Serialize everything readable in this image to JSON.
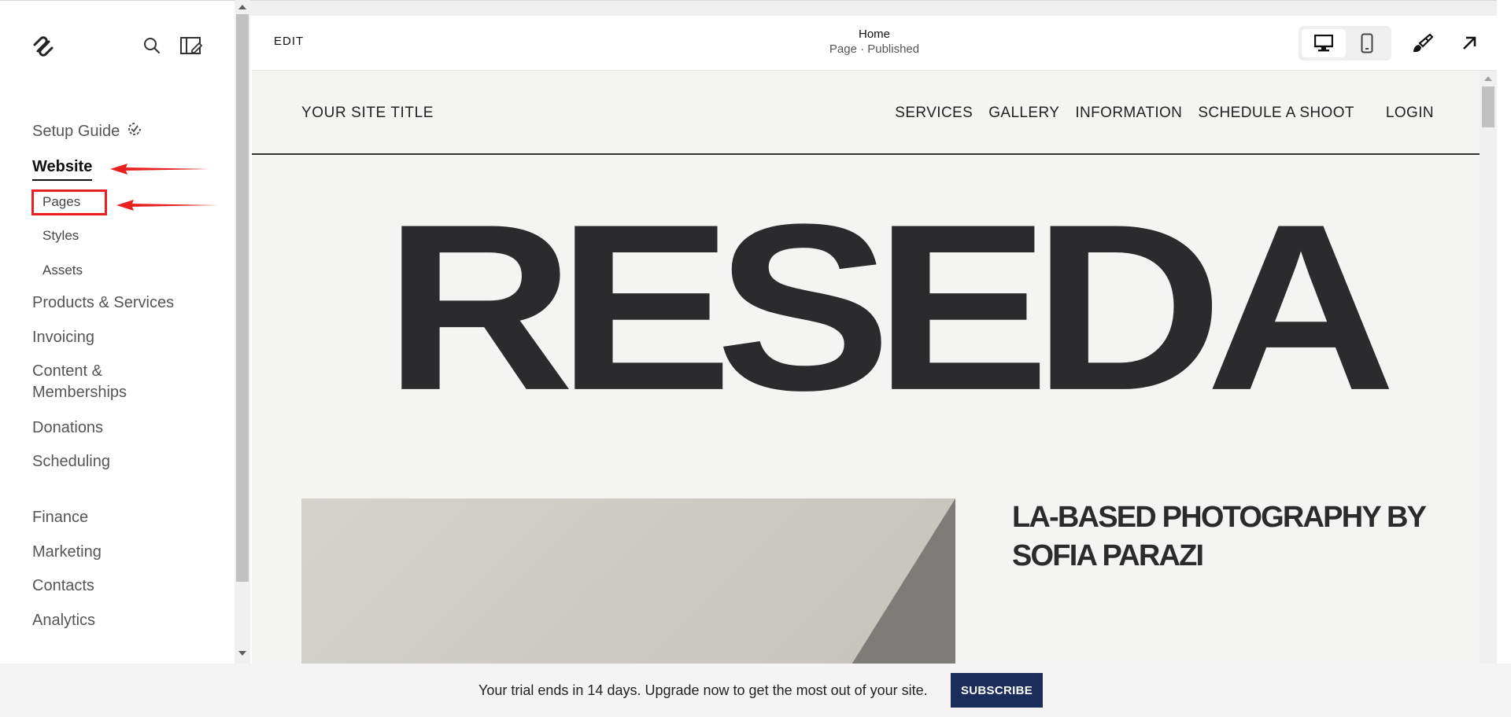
{
  "sidebar": {
    "logo_icon": "squarespace-logo-icon",
    "search_icon": "search-icon",
    "edit_site_icon": "layout-edit-icon",
    "setup_guide": "Setup Guide",
    "setup_guide_icon": "progress-ring-icon",
    "website": "Website",
    "pages": "Pages",
    "styles": "Styles",
    "assets": "Assets",
    "products": "Products & Services",
    "invoicing": "Invoicing",
    "content": "Content & Memberships",
    "donations": "Donations",
    "scheduling": "Scheduling",
    "finance": "Finance",
    "marketing": "Marketing",
    "contacts": "Contacts",
    "analytics": "Analytics"
  },
  "annotations": {
    "highlight_color": "#e8201f"
  },
  "toolbar": {
    "edit_label": "EDIT",
    "page_title": "Home",
    "page_status": "Page · Published",
    "desktop_icon": "desktop-icon",
    "mobile_icon": "mobile-icon",
    "design_icon": "paintbrush-icon",
    "exit_icon": "arrow-up-right-icon"
  },
  "site": {
    "title": "YOUR SITE TITLE",
    "nav": [
      "SERVICES",
      "GALLERY",
      "INFORMATION",
      "SCHEDULE A SHOOT"
    ],
    "login": "LOGIN",
    "hero_word": "RESEDA",
    "tagline": "LA-BASED PHOTOGRAPHY BY SOFIA PARAZI"
  },
  "trial": {
    "message": "Your trial ends in 14 days. Upgrade now to get the most out of your site.",
    "subscribe_label": "SUBSCRIBE",
    "subscribe_color": "#1b2d5b"
  }
}
